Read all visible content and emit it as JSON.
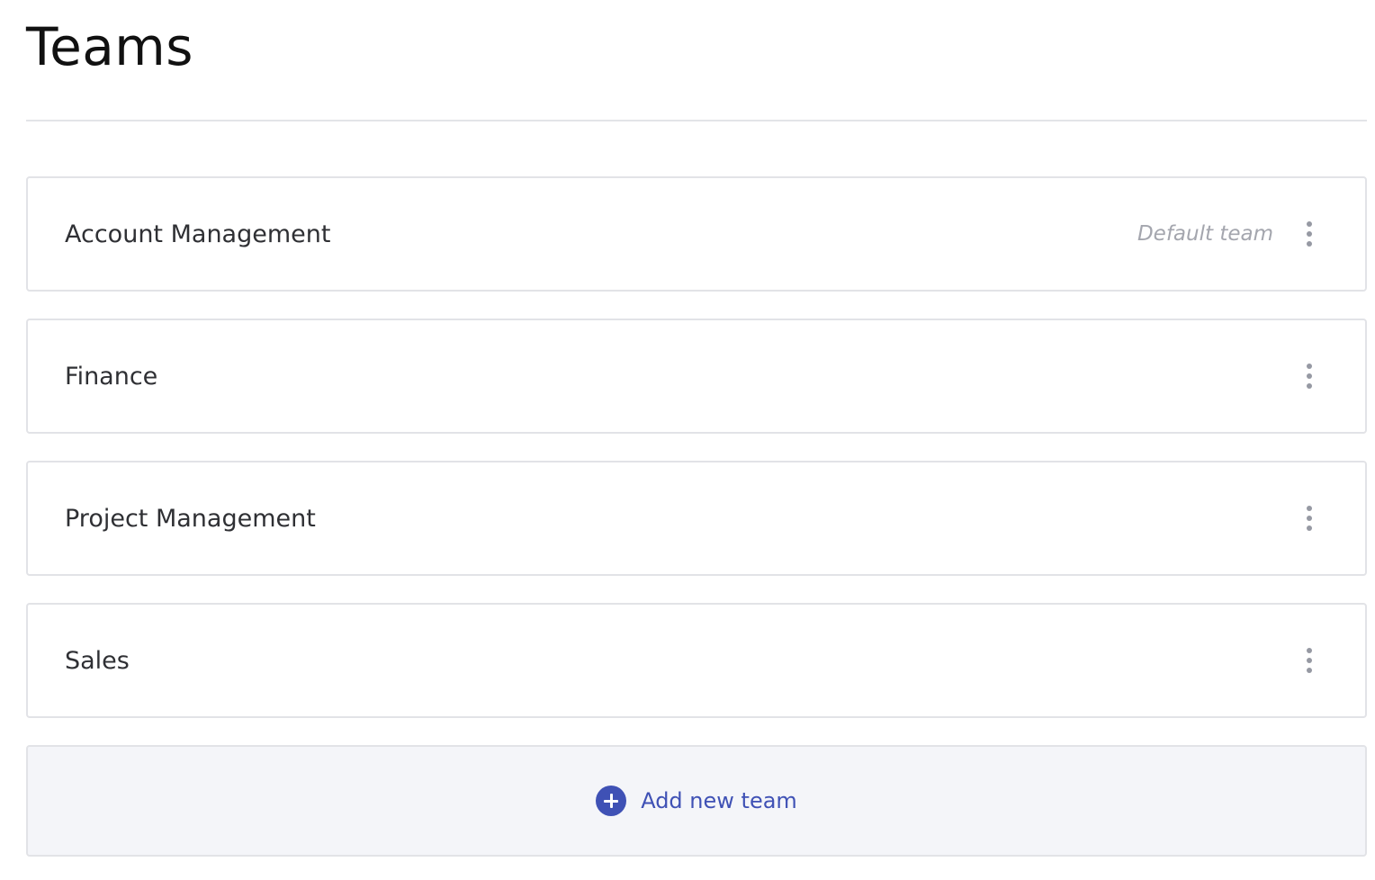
{
  "page": {
    "title": "Teams"
  },
  "teams": [
    {
      "name": "Account Management",
      "badge": "Default team"
    },
    {
      "name": "Finance",
      "badge": ""
    },
    {
      "name": "Project Management",
      "badge": ""
    },
    {
      "name": "Sales",
      "badge": ""
    }
  ],
  "add_team": {
    "label": "Add new team",
    "icon": "plus-circle-icon"
  },
  "icons": {
    "team_menu": "more-vertical-icon"
  },
  "colors": {
    "accent": "#3f51b5",
    "border": "#e2e3e7",
    "add_background": "#f4f5f9",
    "badge_text": "#a4a6ae",
    "menu_dots": "#9699a3"
  }
}
